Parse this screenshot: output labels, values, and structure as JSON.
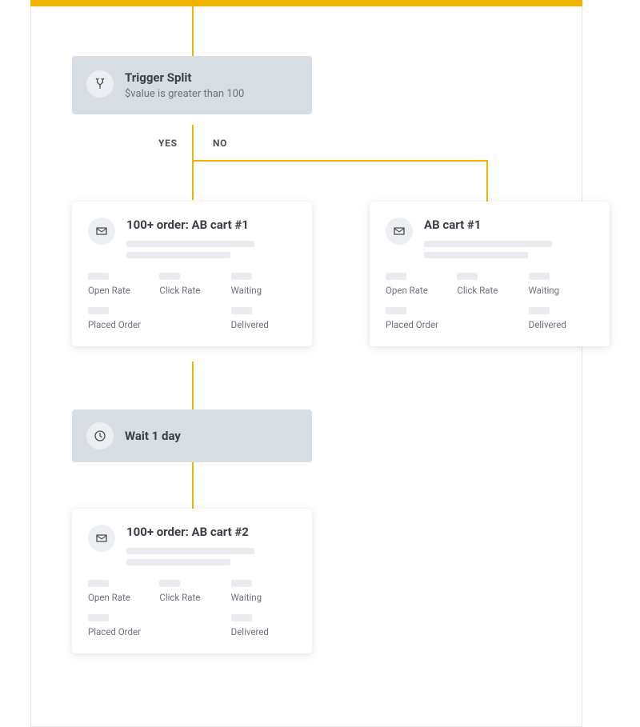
{
  "colors": {
    "accent": "#f0b400"
  },
  "trigger": {
    "title": "Trigger Split",
    "condition": "$value is greater than 100"
  },
  "branches": {
    "yes": "YES",
    "no": "NO"
  },
  "wait": {
    "label": "Wait 1 day"
  },
  "emails": {
    "yes1": {
      "title": "100+ order: AB cart #1",
      "metrics": [
        "Open Rate",
        "Click Rate",
        "Waiting",
        "Placed Order",
        "",
        "Delivered"
      ]
    },
    "yes2": {
      "title": "100+ order: AB cart #2",
      "metrics": [
        "Open Rate",
        "Click Rate",
        "Waiting",
        "Placed Order",
        "",
        "Delivered"
      ]
    },
    "no1": {
      "title": "AB cart #1",
      "metrics": [
        "Open Rate",
        "Click Rate",
        "Waiting",
        "Placed Order",
        "",
        "Delivered"
      ]
    }
  }
}
